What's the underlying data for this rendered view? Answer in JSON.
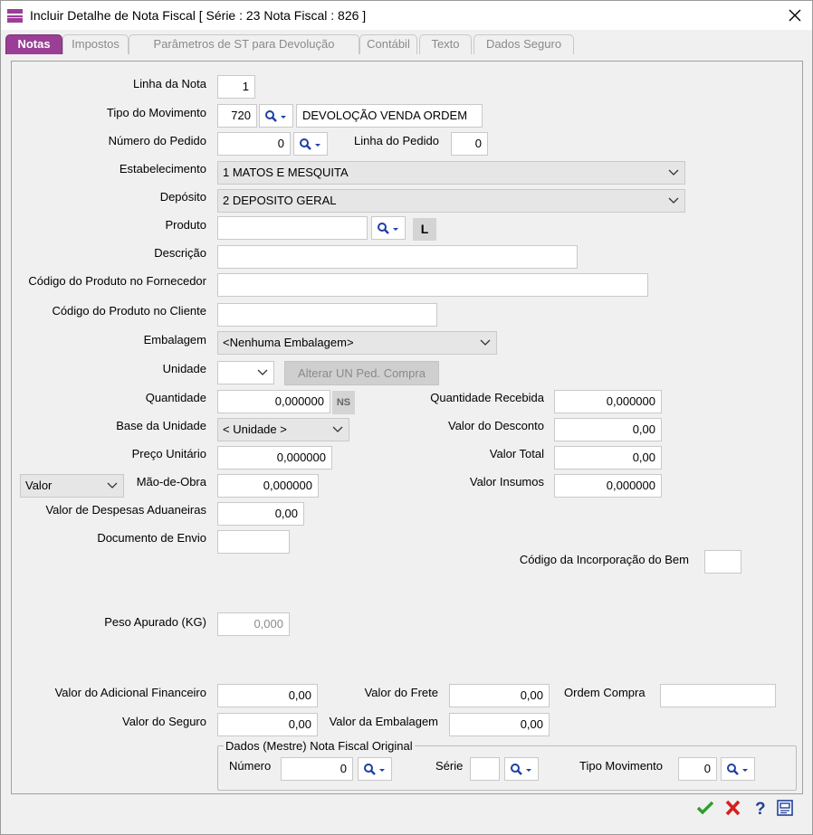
{
  "window": {
    "title": "Incluir Detalhe de Nota Fiscal [ Série : 23  Nota Fiscal : 826 ]"
  },
  "tabs": [
    {
      "label": "Notas",
      "active": true
    },
    {
      "label": "Impostos"
    },
    {
      "label": "Parâmetros de ST para Devolução"
    },
    {
      "label": "Contábil"
    },
    {
      "label": "Texto"
    },
    {
      "label": "Dados Seguro"
    }
  ],
  "form": {
    "linha_nota": {
      "label": "Linha da Nota",
      "value": "1"
    },
    "tipo_movimento": {
      "label": "Tipo do Movimento",
      "code": "720",
      "description": "DEVOLOÇÃO VENDA ORDEM"
    },
    "numero_pedido": {
      "label": "Número do Pedido",
      "value": "0"
    },
    "linha_pedido": {
      "label": "Linha do Pedido",
      "value": "0"
    },
    "estabelecimento": {
      "label": "Estabelecimento",
      "value": "1 MATOS E MESQUITA"
    },
    "deposito": {
      "label": "Depósito",
      "value": "2 DEPOSITO GERAL"
    },
    "produto": {
      "label": "Produto",
      "value": "",
      "l_button": "L"
    },
    "descricao": {
      "label": "Descrição",
      "value": ""
    },
    "cod_fornecedor": {
      "label": "Código do Produto no Fornecedor",
      "value": ""
    },
    "cod_cliente": {
      "label": "Código do Produto no Cliente",
      "value": ""
    },
    "embalagem": {
      "label": "Embalagem",
      "value": "<Nenhuma Embalagem>"
    },
    "unidade": {
      "label": "Unidade",
      "value": "",
      "alterar_button": "Alterar UN Ped. Compra"
    },
    "quantidade": {
      "label": "Quantidade",
      "value": "0,000000",
      "ns_button": "NS"
    },
    "quantidade_recebida": {
      "label": "Quantidade Recebida",
      "value": "0,000000"
    },
    "base_unidade": {
      "label": "Base da Unidade",
      "value": "< Unidade >"
    },
    "valor_desconto": {
      "label": "Valor do Desconto",
      "value": "0,00"
    },
    "preco_unitario": {
      "label": "Preço Unitário",
      "value": "0,000000"
    },
    "valor_total": {
      "label": "Valor Total",
      "value": "0,00"
    },
    "mao_obra_tipo": {
      "value": "Valor"
    },
    "mao_obra": {
      "label": "Mão-de-Obra",
      "value": "0,000000"
    },
    "valor_insumos": {
      "label": "Valor Insumos",
      "value": "0,000000"
    },
    "despesas_aduaneiras": {
      "label": "Valor de Despesas Aduaneiras",
      "value": "0,00"
    },
    "documento_envio": {
      "label": "Documento de Envio",
      "value": ""
    },
    "cod_incorporacao": {
      "label": "Código da Incorporação do Bem",
      "value": ""
    },
    "peso_apurado": {
      "label": "Peso Apurado (KG)",
      "value": "0,000"
    },
    "adicional_financeiro": {
      "label": "Valor do Adicional Financeiro",
      "value": "0,00"
    },
    "valor_frete": {
      "label": "Valor do Frete",
      "value": "0,00"
    },
    "ordem_compra": {
      "label": "Ordem Compra",
      "value": ""
    },
    "valor_seguro": {
      "label": "Valor do Seguro",
      "value": "0,00"
    },
    "valor_embalagem": {
      "label": "Valor da Embalagem",
      "value": "0,00"
    }
  },
  "original": {
    "title": "Dados (Mestre) Nota Fiscal Original",
    "numero": {
      "label": "Número",
      "value": "0"
    },
    "serie": {
      "label": "Série",
      "value": ""
    },
    "tipo_movimento": {
      "label": "Tipo Movimento",
      "value": "0"
    }
  },
  "colors": {
    "accent": "#9b3f96",
    "ok": "#2e9e2e",
    "cancel": "#d62020",
    "help": "#1f3f99"
  }
}
